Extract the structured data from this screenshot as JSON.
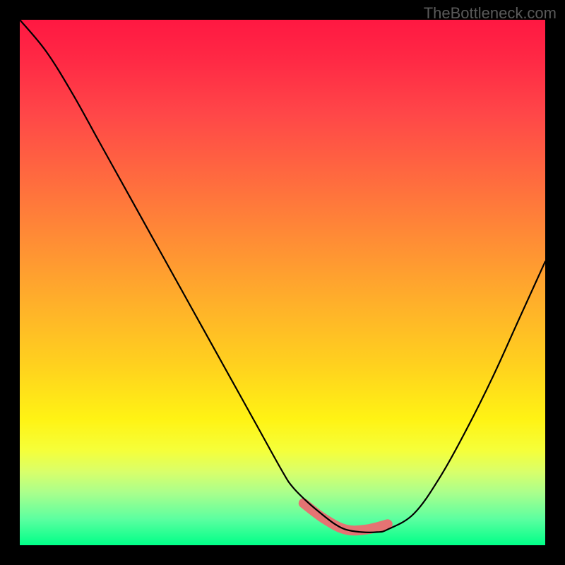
{
  "watermark": "TheBottleneck.com",
  "colors": {
    "page_bg": "#000000",
    "watermark_text": "#5a5a5a",
    "curve": "#000000",
    "valley_marker": "#e57373",
    "gradient_top": "#ff1842",
    "gradient_bottom": "#00ff88"
  },
  "plot": {
    "x_range": [
      0,
      100
    ],
    "y_range": [
      0,
      100
    ]
  },
  "chart_data": {
    "type": "line",
    "title": "",
    "xlabel": "",
    "ylabel": "",
    "xlim": [
      0,
      100
    ],
    "ylim": [
      0,
      100
    ],
    "series": [
      {
        "name": "bottleneck-curve",
        "x": [
          0,
          5,
          10,
          15,
          20,
          25,
          30,
          35,
          40,
          45,
          50,
          52,
          55,
          58,
          60,
          62,
          65,
          68,
          70,
          75,
          80,
          85,
          90,
          95,
          100
        ],
        "y": [
          100,
          94,
          86,
          77,
          68,
          59,
          50,
          41,
          32,
          23,
          14,
          11,
          8,
          5.5,
          4,
          3,
          2.5,
          2.5,
          3,
          6,
          13,
          22,
          32,
          43,
          54
        ]
      },
      {
        "name": "valley-fit-marker",
        "x": [
          54,
          58,
          62,
          66,
          70
        ],
        "y": [
          8,
          5,
          3,
          3,
          4
        ]
      }
    ]
  }
}
